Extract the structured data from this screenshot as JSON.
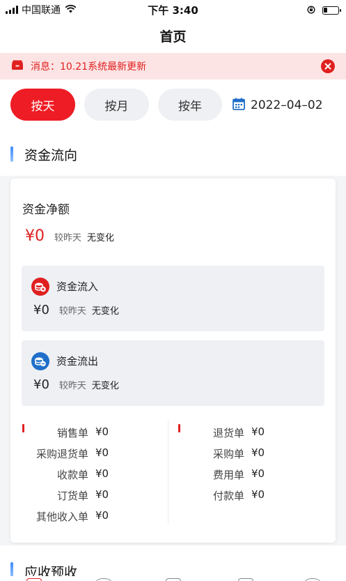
{
  "status_bar": {
    "carrier": "中国联通",
    "time": "下午 3:40"
  },
  "nav": {
    "title": "首页"
  },
  "notice": {
    "text": "消息：10.21系统最新更新"
  },
  "filters": {
    "day": "按天",
    "month": "按月",
    "year": "按年",
    "active": "day",
    "date": "2022–04–02"
  },
  "section": {
    "title": "资金流向"
  },
  "net": {
    "title": "资金净额",
    "amount": "¥0",
    "compare_label": "较昨天",
    "compare_value": "无变化"
  },
  "inflow": {
    "title": "资金流入",
    "amount": "¥0",
    "compare_label": "较昨天",
    "compare_value": "无变化"
  },
  "outflow": {
    "title": "资金流出",
    "amount": "¥0",
    "compare_label": "较昨天",
    "compare_value": "无变化"
  },
  "details_left": [
    {
      "label": "销售单",
      "value": "¥0"
    },
    {
      "label": "采购退货单",
      "value": "¥0"
    },
    {
      "label": "收款单",
      "value": "¥0"
    },
    {
      "label": "订货单",
      "value": "¥0"
    },
    {
      "label": "其他收入单",
      "value": "¥0"
    }
  ],
  "details_right": [
    {
      "label": "退货单",
      "value": "¥0"
    },
    {
      "label": "采购单",
      "value": "¥0"
    },
    {
      "label": "费用单",
      "value": "¥0"
    },
    {
      "label": "付款单",
      "value": "¥0"
    }
  ],
  "next_section": {
    "title": "应收预收"
  },
  "colors": {
    "accent": "#ee1c24",
    "inflow_icon": "#e02020",
    "outflow_icon": "#1f6fc9",
    "section_bar": "#3b8bff"
  },
  "icons": {
    "notice": "shop-icon",
    "close": "close-circle-icon",
    "calendar": "calendar-icon",
    "inflow": "coin-stack-icon",
    "outflow": "coin-stack-icon"
  }
}
